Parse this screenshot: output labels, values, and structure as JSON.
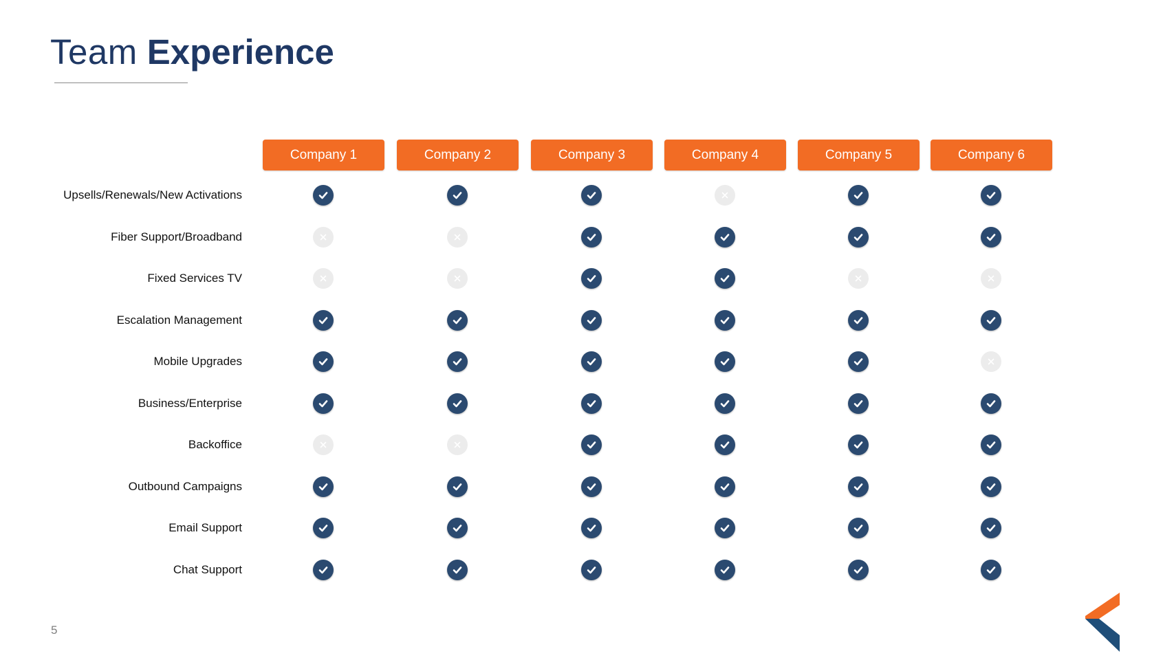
{
  "title": {
    "light": "Team",
    "bold": "Experience"
  },
  "columns": [
    "Company 1",
    "Company 2",
    "Company 3",
    "Company 4",
    "Company 5",
    "Company 6"
  ],
  "rows": [
    {
      "label": "Upsells/Renewals/New Activations",
      "values": [
        true,
        true,
        true,
        false,
        true,
        true
      ]
    },
    {
      "label": "Fiber Support/Broadband",
      "values": [
        false,
        false,
        true,
        true,
        true,
        true
      ]
    },
    {
      "label": "Fixed Services TV",
      "values": [
        false,
        false,
        true,
        true,
        false,
        false
      ]
    },
    {
      "label": "Escalation Management",
      "values": [
        true,
        true,
        true,
        true,
        true,
        true
      ]
    },
    {
      "label": "Mobile Upgrades",
      "values": [
        true,
        true,
        true,
        true,
        true,
        false
      ]
    },
    {
      "label": "Business/Enterprise",
      "values": [
        true,
        true,
        true,
        true,
        true,
        true
      ]
    },
    {
      "label": "Backoffice",
      "values": [
        false,
        false,
        true,
        true,
        true,
        true
      ]
    },
    {
      "label": "Outbound Campaigns",
      "values": [
        true,
        true,
        true,
        true,
        true,
        true
      ]
    },
    {
      "label": "Email Support",
      "values": [
        true,
        true,
        true,
        true,
        true,
        true
      ]
    },
    {
      "label": "Chat Support",
      "values": [
        true,
        true,
        true,
        true,
        true,
        true
      ]
    }
  ],
  "page_number": "5",
  "colors": {
    "header_bg": "#f26c24",
    "check_bg": "#2b4a70",
    "cross_bg": "#ececec",
    "title": "#1f3864",
    "logo_orange": "#f26c24",
    "logo_navy": "#1f4e79"
  },
  "icons": {
    "yes": "check-circle-icon",
    "no": "cross-circle-icon"
  }
}
